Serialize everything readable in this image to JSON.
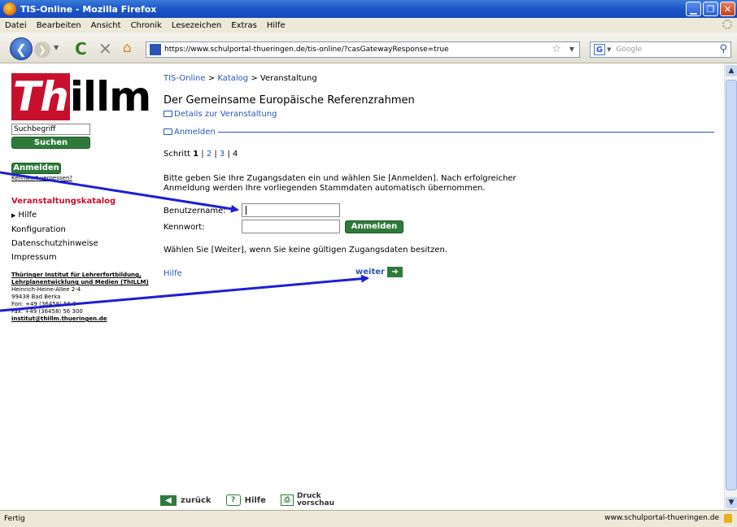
{
  "window": {
    "title": "TIS-Online - Mozilla Firefox"
  },
  "menu": [
    "Datei",
    "Bearbeiten",
    "Ansicht",
    "Chronik",
    "Lesezeichen",
    "Extras",
    "Hilfe"
  ],
  "toolbar": {
    "url": "https://www.schulportal-thueringen.de/tis-online/?casGatewayResponse=true",
    "search_placeholder": "Google"
  },
  "sidebar": {
    "logo_th": "Th",
    "logo_rest": "illm",
    "search_value": "Suchbegriff",
    "search_button": "Suchen",
    "login_button": "Anmelden",
    "pw_forgot": "Kennwort vergessen?",
    "nav": [
      {
        "label": "Veranstaltungskatalog"
      },
      {
        "label": "Hilfe"
      },
      {
        "label": "Konfiguration"
      },
      {
        "label": "Datenschutzhinweise"
      },
      {
        "label": "Impressum"
      }
    ],
    "address": {
      "org": "Thüringer Institut für Lehrerfortbildung, Lehrplanentwicklung und Medien (ThILLM)",
      "street": "Heinrich-Heine-Allee 2-4",
      "city": "99438 Bad Berka",
      "phone": "Fon: +49 (36458) 56 0",
      "fax": "Fax: +49 (36458) 56 300",
      "email": "institut@thillm.thueringen.de"
    }
  },
  "main": {
    "breadcrumb": [
      "TIS-Online",
      "Katalog",
      "Veranstaltung"
    ],
    "breadcrumb_sep": ">",
    "title": "Der Gemeinsame Europäische Referenzrahmen",
    "details_link": "Details zur Veranstaltung",
    "section": "Anmelden",
    "steps_label": "Schritt",
    "steps": [
      "1",
      "2",
      "3",
      "4"
    ],
    "info": "Bitte geben Sie Ihre Zugangsdaten ein und wählen Sie [Anmelden]. Nach erfolgreicher Anmeldung werden Ihre vorliegenden Stammdaten automatisch übernommen.",
    "username_label": "Benutzername:",
    "password_label": "Kennwort:",
    "login_button": "Anmelden",
    "weiter_hint": "Wählen Sie [Weiter], wenn Sie keine gültigen Zugangsdaten besitzen.",
    "help_link": "Hilfe",
    "next_link": "weiter"
  },
  "footer": {
    "back": "zurück",
    "help": "Hilfe",
    "print_1": "Druck",
    "print_2": "vorschau"
  },
  "status": {
    "left": "Fertig",
    "right": "www.schulportal-thueringen.de"
  },
  "colors": {
    "accent_red": "#c8102e",
    "link_blue": "#2a56b5",
    "button_green": "#2f7a3a",
    "annotation_arrow": "#1e1ed6"
  }
}
